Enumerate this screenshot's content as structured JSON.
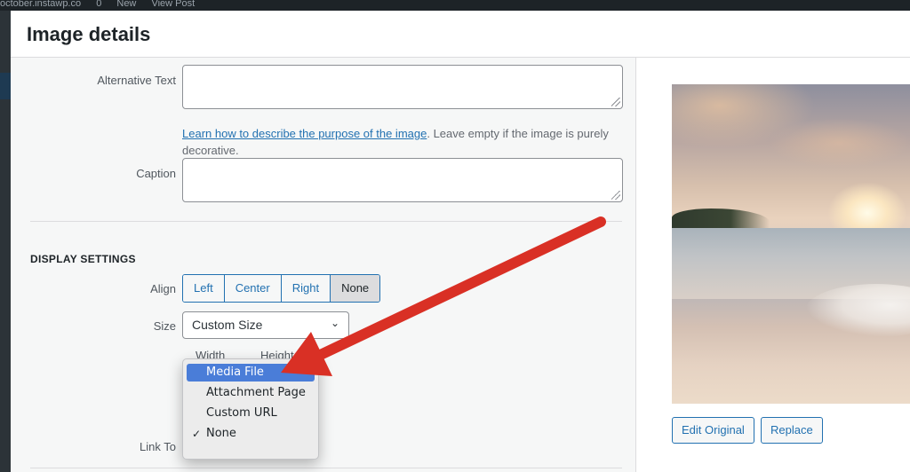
{
  "topbar": {
    "items": [
      "october.instawp.co",
      "0",
      "New",
      "View Post"
    ]
  },
  "modal": {
    "title": "Image details"
  },
  "alt_text": {
    "label": "Alternative Text",
    "value": "",
    "help_link": "Learn how to describe the purpose of the image",
    "help_text": ". Leave empty if the image is purely decorative."
  },
  "caption": {
    "label": "Caption",
    "value": ""
  },
  "display_settings": {
    "heading": "DISPLAY SETTINGS",
    "align": {
      "label": "Align",
      "options": [
        "Left",
        "Center",
        "Right",
        "None"
      ],
      "selected": "None"
    },
    "size": {
      "label": "Size",
      "value": "Custom Size"
    },
    "width_label": "Width",
    "height_label": "Height",
    "link_to": {
      "label": "Link To",
      "options": [
        "Media File",
        "Attachment Page",
        "Custom URL",
        "None"
      ],
      "highlighted": "Media File",
      "checked": "None"
    }
  },
  "image_panel": {
    "edit_original": "Edit Original",
    "replace": "Replace"
  },
  "annotation": {
    "arrow_color": "#d93025"
  },
  "colors": {
    "accent": "#2271b1",
    "highlight": "#4a7dd8"
  }
}
